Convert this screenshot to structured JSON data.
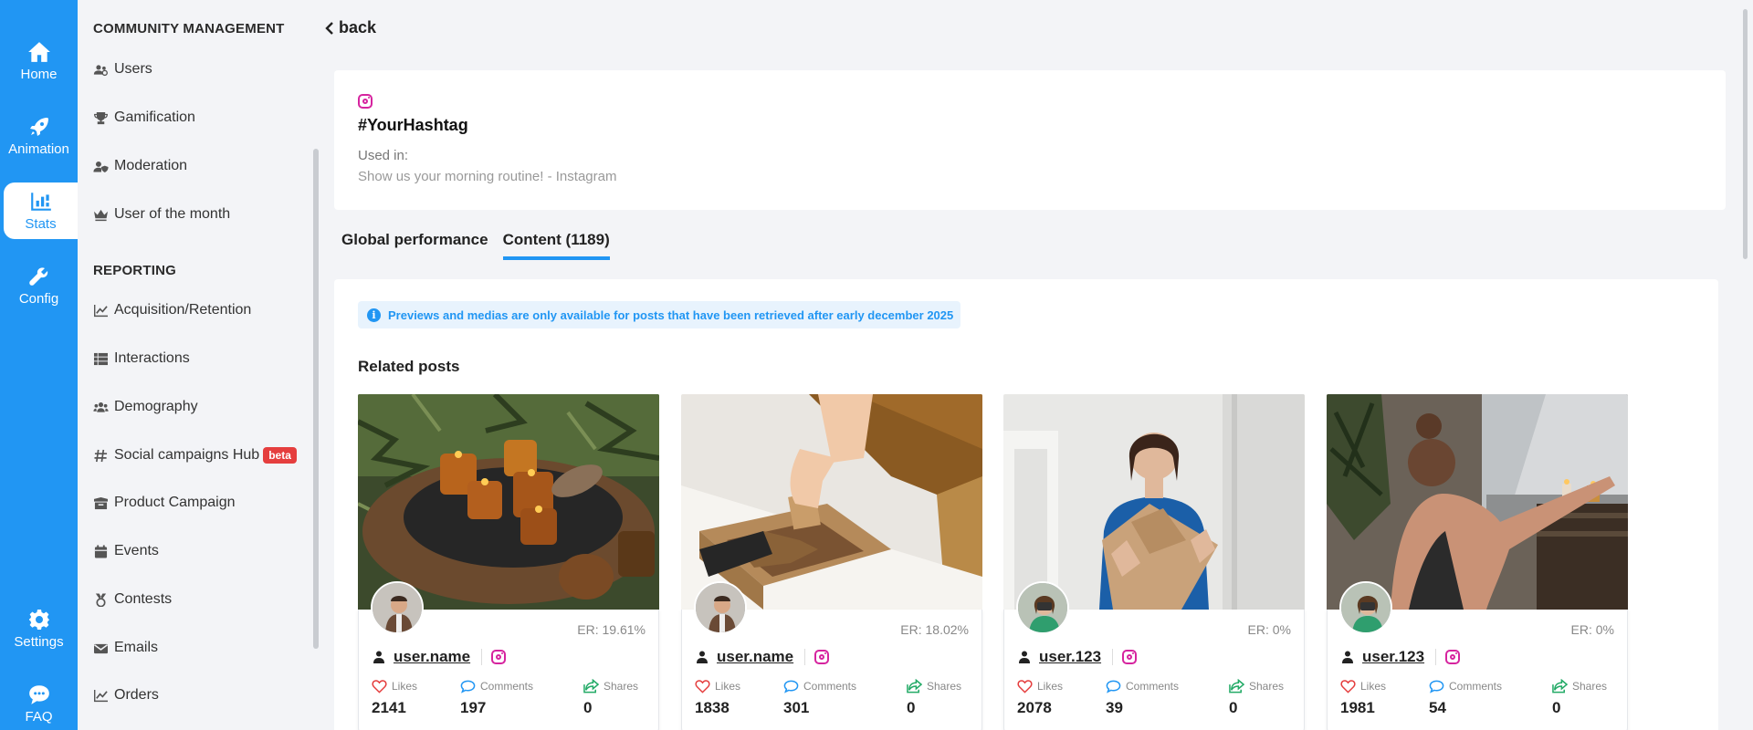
{
  "rail": {
    "items": [
      {
        "label": "Home",
        "icon": "home-icon"
      },
      {
        "label": "Animation",
        "icon": "rocket-icon"
      },
      {
        "label": "Stats",
        "icon": "bar-chart-icon"
      },
      {
        "label": "Config",
        "icon": "wrench-icon"
      },
      {
        "label": "Settings",
        "icon": "gear-icon"
      },
      {
        "label": "FAQ",
        "icon": "chat-icon"
      }
    ],
    "active": "Stats",
    "color": "#2196f3"
  },
  "subnav": {
    "community_title": "COMMUNITY MANAGEMENT",
    "community_items": [
      {
        "label": "Users",
        "icon": "users-icon"
      },
      {
        "label": "Gamification",
        "icon": "trophy-icon"
      },
      {
        "label": "Moderation",
        "icon": "user-shield-icon"
      },
      {
        "label": "User of the month",
        "icon": "crown-icon"
      }
    ],
    "reporting_title": "REPORTING",
    "reporting_items": [
      {
        "label": "Acquisition/Retention",
        "icon": "line-chart-icon"
      },
      {
        "label": "Interactions",
        "icon": "list-icon"
      },
      {
        "label": "Demography",
        "icon": "people-icon"
      },
      {
        "label": "Social campaigns Hub",
        "icon": "hash-icon",
        "badge": "beta"
      },
      {
        "label": "Product Campaign",
        "icon": "box-icon"
      },
      {
        "label": "Events",
        "icon": "calendar-icon"
      },
      {
        "label": "Contests",
        "icon": "medal-icon"
      },
      {
        "label": "Emails",
        "icon": "envelope-icon"
      },
      {
        "label": "Orders",
        "icon": "line-chart-icon"
      }
    ]
  },
  "back_label": "back",
  "hashtag": {
    "platform_icon": "instagram-icon",
    "title": "#YourHashtag",
    "used_in_label": "Used in:",
    "used_in_value": "Show us your morning routine! - Instagram"
  },
  "tabs": [
    {
      "label": "Global performance",
      "active": false
    },
    {
      "label": "Content (1189)",
      "active": true
    }
  ],
  "info_banner": "Previews and medias are only available for posts that have been retrieved after early december 2025",
  "related_title": "Related posts",
  "metric_labels": {
    "likes": "Likes",
    "comments": "Comments",
    "shares": "Shares"
  },
  "posts": [
    {
      "image": "candles",
      "er": "ER: 19.61%",
      "username": "user.name",
      "likes": "2141",
      "comments": "197",
      "shares": "0"
    },
    {
      "image": "box",
      "er": "ER: 18.02%",
      "username": "user.name",
      "likes": "1838",
      "comments": "301",
      "shares": "0"
    },
    {
      "image": "woman-bag",
      "er": "ER: 0%",
      "username": "user.123",
      "likes": "2078",
      "comments": "39",
      "shares": "0"
    },
    {
      "image": "woman-window",
      "er": "ER: 0%",
      "username": "user.123",
      "likes": "1981",
      "comments": "54",
      "shares": "0"
    }
  ],
  "colors": {
    "accent": "#2196f3",
    "instagram": "#d6249f",
    "beta": "#e53e3e",
    "likes": "#e53e3e",
    "comments": "#2196f3",
    "shares": "#22aa66"
  }
}
